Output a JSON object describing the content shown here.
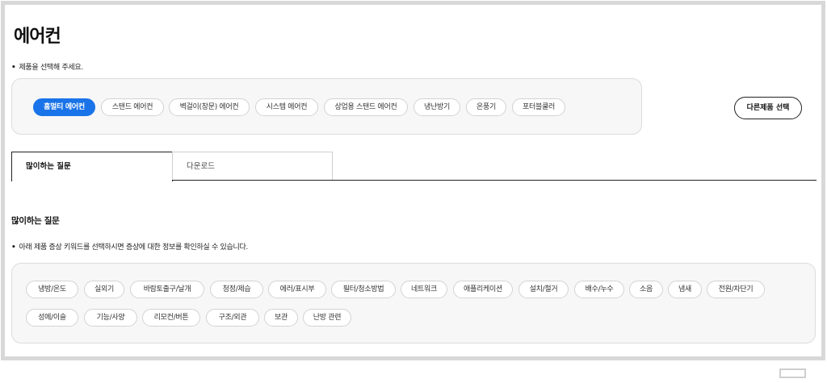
{
  "page": {
    "title": "에어컨",
    "select_note": "제품을 선택해 주세요."
  },
  "products": {
    "items": [
      {
        "label": "홈멀티 에어컨",
        "active": true
      },
      {
        "label": "스탠드 에어컨",
        "active": false
      },
      {
        "label": "벽걸이(창문) 에어컨",
        "active": false
      },
      {
        "label": "시스템 에어컨",
        "active": false
      },
      {
        "label": "상업용 스탠드 에어컨",
        "active": false
      },
      {
        "label": "냉난방기",
        "active": false
      },
      {
        "label": "온풍기",
        "active": false
      },
      {
        "label": "포터블쿨러",
        "active": false
      }
    ],
    "other_button": "다른제품 선택"
  },
  "tabs": [
    {
      "label": "많이하는 질문",
      "active": true
    },
    {
      "label": "다운로드",
      "active": false
    }
  ],
  "faq": {
    "title": "많이하는 질문",
    "note": "아래 제품 증상 키워드를 선택하시면 증상에 대한 정보를 확인하실 수 있습니다.",
    "keywords_row1": [
      "냉방/온도",
      "실외기",
      "바람토출구/날개",
      "청정/제습",
      "에러/표시부",
      "필터/청소방법",
      "네트워크",
      "애플리케이션",
      "설치/철거",
      "배수/누수",
      "소음",
      "냄새",
      "전원/차단기"
    ],
    "keywords_row2": [
      "성에/이슬",
      "기능/사양",
      "리모컨/버튼",
      "구조/외관",
      "보관",
      "난방 관련"
    ]
  },
  "colors": {
    "accent": "#1a73e8",
    "border": "#dcdcdc",
    "panel_bg": "#f7f7f7"
  },
  "icons": {
    "corner": "window-icon"
  }
}
